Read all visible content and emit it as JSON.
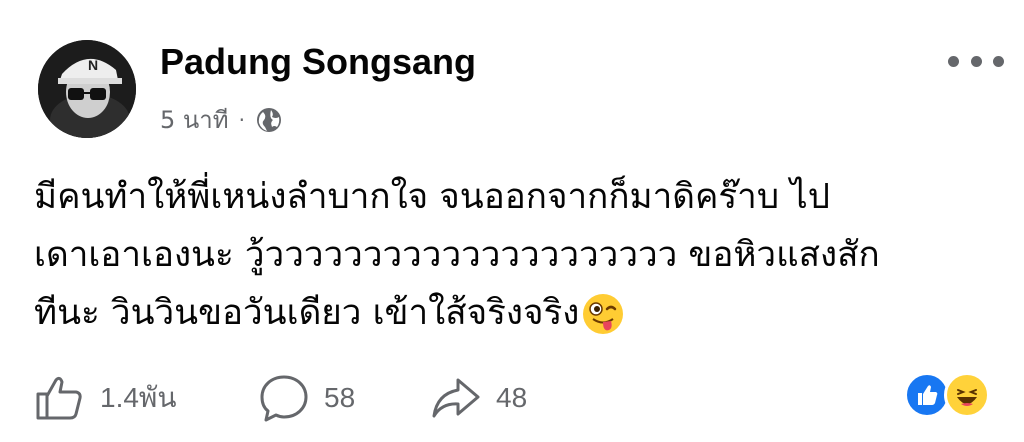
{
  "post": {
    "author": "Padung Songsang",
    "time": "5 นาที",
    "separator": "·",
    "audience_icon": "globe-icon",
    "text": "มีคนทำให้พี่เหน่งลำบากใจ จนออกจากก็มาดิคร๊าบ  ไป\nเดาเอาเองนะ  วู้ววววววววววววววววววววว ขอหิวแสงสัก\nทีนะ วินวินขอวันเดียว เข้าใส้จริงจริง",
    "trailing_emoji": "winking-face-tongue-emoji"
  },
  "actions": {
    "like_count": "1.4พัน",
    "comment_count": "58",
    "share_count": "48"
  },
  "reactions": [
    "like",
    "haha"
  ],
  "colors": {
    "secondary_text": "#65676b",
    "like_blue": "#1877f2",
    "haha_yellow": "#ffd23a"
  }
}
